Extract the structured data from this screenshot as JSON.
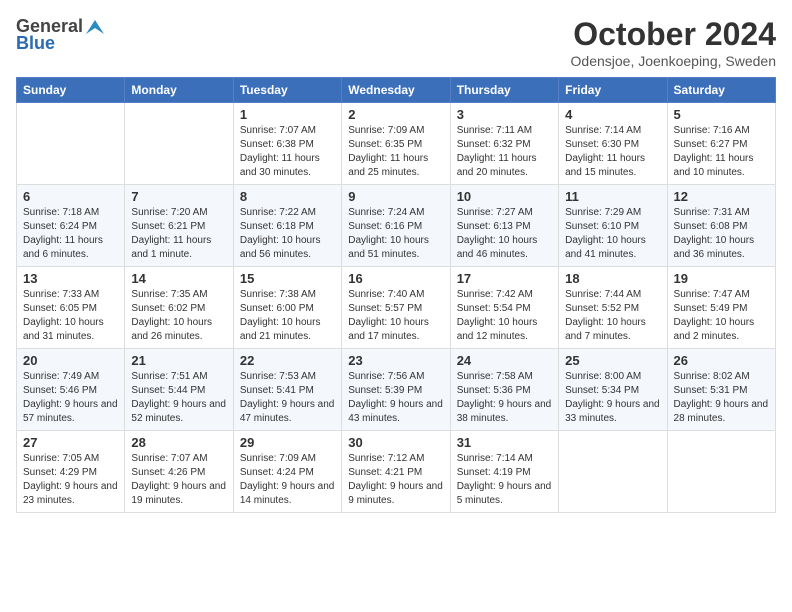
{
  "logo": {
    "general": "General",
    "blue": "Blue"
  },
  "title": "October 2024",
  "location": "Odensjoe, Joenkoeping, Sweden",
  "headers": [
    "Sunday",
    "Monday",
    "Tuesday",
    "Wednesday",
    "Thursday",
    "Friday",
    "Saturday"
  ],
  "weeks": [
    [
      {
        "day": "",
        "info": ""
      },
      {
        "day": "",
        "info": ""
      },
      {
        "day": "1",
        "info": "Sunrise: 7:07 AM\nSunset: 6:38 PM\nDaylight: 11 hours and 30 minutes."
      },
      {
        "day": "2",
        "info": "Sunrise: 7:09 AM\nSunset: 6:35 PM\nDaylight: 11 hours and 25 minutes."
      },
      {
        "day": "3",
        "info": "Sunrise: 7:11 AM\nSunset: 6:32 PM\nDaylight: 11 hours and 20 minutes."
      },
      {
        "day": "4",
        "info": "Sunrise: 7:14 AM\nSunset: 6:30 PM\nDaylight: 11 hours and 15 minutes."
      },
      {
        "day": "5",
        "info": "Sunrise: 7:16 AM\nSunset: 6:27 PM\nDaylight: 11 hours and 10 minutes."
      }
    ],
    [
      {
        "day": "6",
        "info": "Sunrise: 7:18 AM\nSunset: 6:24 PM\nDaylight: 11 hours and 6 minutes."
      },
      {
        "day": "7",
        "info": "Sunrise: 7:20 AM\nSunset: 6:21 PM\nDaylight: 11 hours and 1 minute."
      },
      {
        "day": "8",
        "info": "Sunrise: 7:22 AM\nSunset: 6:18 PM\nDaylight: 10 hours and 56 minutes."
      },
      {
        "day": "9",
        "info": "Sunrise: 7:24 AM\nSunset: 6:16 PM\nDaylight: 10 hours and 51 minutes."
      },
      {
        "day": "10",
        "info": "Sunrise: 7:27 AM\nSunset: 6:13 PM\nDaylight: 10 hours and 46 minutes."
      },
      {
        "day": "11",
        "info": "Sunrise: 7:29 AM\nSunset: 6:10 PM\nDaylight: 10 hours and 41 minutes."
      },
      {
        "day": "12",
        "info": "Sunrise: 7:31 AM\nSunset: 6:08 PM\nDaylight: 10 hours and 36 minutes."
      }
    ],
    [
      {
        "day": "13",
        "info": "Sunrise: 7:33 AM\nSunset: 6:05 PM\nDaylight: 10 hours and 31 minutes."
      },
      {
        "day": "14",
        "info": "Sunrise: 7:35 AM\nSunset: 6:02 PM\nDaylight: 10 hours and 26 minutes."
      },
      {
        "day": "15",
        "info": "Sunrise: 7:38 AM\nSunset: 6:00 PM\nDaylight: 10 hours and 21 minutes."
      },
      {
        "day": "16",
        "info": "Sunrise: 7:40 AM\nSunset: 5:57 PM\nDaylight: 10 hours and 17 minutes."
      },
      {
        "day": "17",
        "info": "Sunrise: 7:42 AM\nSunset: 5:54 PM\nDaylight: 10 hours and 12 minutes."
      },
      {
        "day": "18",
        "info": "Sunrise: 7:44 AM\nSunset: 5:52 PM\nDaylight: 10 hours and 7 minutes."
      },
      {
        "day": "19",
        "info": "Sunrise: 7:47 AM\nSunset: 5:49 PM\nDaylight: 10 hours and 2 minutes."
      }
    ],
    [
      {
        "day": "20",
        "info": "Sunrise: 7:49 AM\nSunset: 5:46 PM\nDaylight: 9 hours and 57 minutes."
      },
      {
        "day": "21",
        "info": "Sunrise: 7:51 AM\nSunset: 5:44 PM\nDaylight: 9 hours and 52 minutes."
      },
      {
        "day": "22",
        "info": "Sunrise: 7:53 AM\nSunset: 5:41 PM\nDaylight: 9 hours and 47 minutes."
      },
      {
        "day": "23",
        "info": "Sunrise: 7:56 AM\nSunset: 5:39 PM\nDaylight: 9 hours and 43 minutes."
      },
      {
        "day": "24",
        "info": "Sunrise: 7:58 AM\nSunset: 5:36 PM\nDaylight: 9 hours and 38 minutes."
      },
      {
        "day": "25",
        "info": "Sunrise: 8:00 AM\nSunset: 5:34 PM\nDaylight: 9 hours and 33 minutes."
      },
      {
        "day": "26",
        "info": "Sunrise: 8:02 AM\nSunset: 5:31 PM\nDaylight: 9 hours and 28 minutes."
      }
    ],
    [
      {
        "day": "27",
        "info": "Sunrise: 7:05 AM\nSunset: 4:29 PM\nDaylight: 9 hours and 23 minutes."
      },
      {
        "day": "28",
        "info": "Sunrise: 7:07 AM\nSunset: 4:26 PM\nDaylight: 9 hours and 19 minutes."
      },
      {
        "day": "29",
        "info": "Sunrise: 7:09 AM\nSunset: 4:24 PM\nDaylight: 9 hours and 14 minutes."
      },
      {
        "day": "30",
        "info": "Sunrise: 7:12 AM\nSunset: 4:21 PM\nDaylight: 9 hours and 9 minutes."
      },
      {
        "day": "31",
        "info": "Sunrise: 7:14 AM\nSunset: 4:19 PM\nDaylight: 9 hours and 5 minutes."
      },
      {
        "day": "",
        "info": ""
      },
      {
        "day": "",
        "info": ""
      }
    ]
  ]
}
